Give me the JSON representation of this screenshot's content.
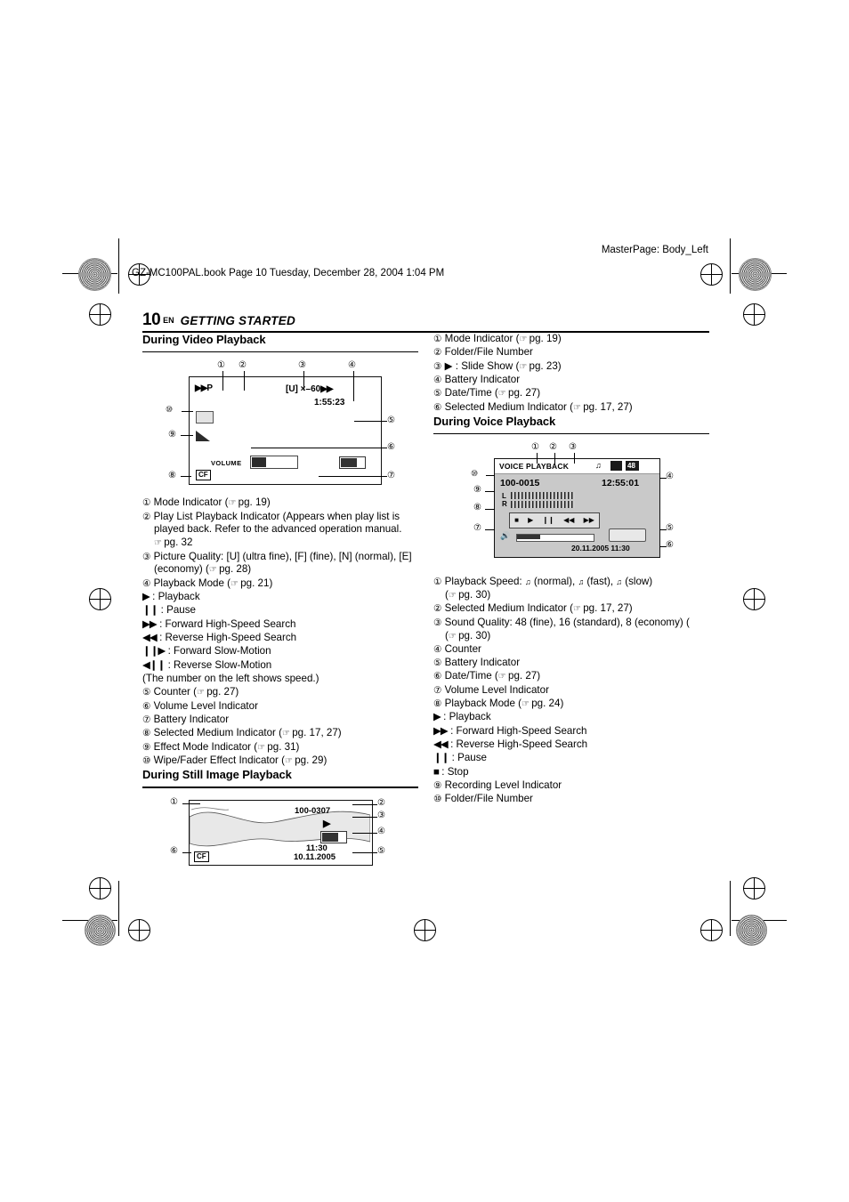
{
  "printmarks": {
    "masterpage": "MasterPage: Body_Left",
    "booktag": "GZ-MC100PAL.book  Page 10  Tuesday, December 28, 2004  1:04 PM"
  },
  "header": {
    "page_number": "10",
    "lang": "EN",
    "section_title": "GETTING STARTED"
  },
  "left_column": {
    "section1_title": "During Video Playback",
    "video_screen": {
      "mode": "P",
      "quality": "[U]",
      "speed": "×–60",
      "counter": "1:55:23",
      "volume_label": "VOLUME",
      "medium": "CF",
      "callouts": [
        "1",
        "2",
        "3",
        "4",
        "5",
        "6",
        "7",
        "8",
        "9",
        "10"
      ]
    },
    "items": [
      {
        "n": "1",
        "text": "Mode Indicator (",
        "ref": "pg. 19",
        "tail": ")"
      },
      {
        "n": "2",
        "text": "Play List Playback Indicator (Appears when play list is played back. Refer to the advanced operation manual. ",
        "ref": "pg. 32",
        "tail": ""
      },
      {
        "n": "3",
        "text": "Picture Quality: [U] (ultra fine), [F] (fine), [N] (normal), [E] (economy) (",
        "ref": "pg. 28",
        "tail": ")"
      },
      {
        "n": "4",
        "text": "Playback Mode (",
        "ref": "pg. 21",
        "tail": ")"
      },
      {
        "n": "5",
        "text": "Counter (",
        "ref": "pg. 27",
        "tail": ")"
      },
      {
        "n": "6",
        "text": "Volume Level Indicator",
        "ref": "",
        "tail": ""
      },
      {
        "n": "7",
        "text": "Battery Indicator",
        "ref": "",
        "tail": ""
      },
      {
        "n": "8",
        "text": "Selected Medium Indicator (",
        "ref": "pg. 17, 27",
        "tail": ")"
      },
      {
        "n": "9",
        "text": "Effect Mode Indicator (",
        "ref": "pg. 31",
        "tail": ")"
      },
      {
        "n": "10",
        "text": "Wipe/Fader Effect Indicator (",
        "ref": "pg. 29",
        "tail": ")"
      }
    ],
    "playback_modes": [
      {
        "icon": "▶",
        "label": ": Playback"
      },
      {
        "icon": "❙❙",
        "label": ": Pause"
      },
      {
        "icon": "▶▶",
        "label": ": Forward High-Speed Search"
      },
      {
        "icon": "◀◀",
        "label": ": Reverse High-Speed Search"
      },
      {
        "icon": "❙❙▶",
        "label": ": Forward Slow-Motion"
      },
      {
        "icon": "◀❙❙",
        "label": ": Reverse Slow-Motion"
      },
      {
        "icon": "",
        "label": "(The number on the left shows speed.)"
      }
    ],
    "section2_title": "During Still Image Playback",
    "still_screen": {
      "file_number": "100-0307",
      "play_icon": "▶",
      "time": "11:30",
      "date": "10.11.2005",
      "medium": "CF",
      "callouts": [
        "1",
        "2",
        "3",
        "4",
        "5",
        "6"
      ]
    }
  },
  "right_column": {
    "still_items": [
      {
        "n": "1",
        "text": "Mode Indicator (",
        "ref": "pg. 19",
        "tail": ")"
      },
      {
        "n": "2",
        "text": "Folder/File Number",
        "ref": "",
        "tail": ""
      },
      {
        "n": "3",
        "text": "▶ : Slide Show (",
        "ref": "pg. 23",
        "tail": ")"
      },
      {
        "n": "4",
        "text": "Battery Indicator",
        "ref": "",
        "tail": ""
      },
      {
        "n": "5",
        "text": "Date/Time (",
        "ref": "pg. 27",
        "tail": ")"
      },
      {
        "n": "6",
        "text": "Selected Medium Indicator (",
        "ref": "pg. 17, 27",
        "tail": ")"
      }
    ],
    "section_title": "During Voice Playback",
    "voice_screen": {
      "title": "VOICE PLAYBACK",
      "quality": "48",
      "file_number": "100-0015",
      "counter": "12:55:01",
      "ch_left": "L",
      "ch_right": "R",
      "datetime": "20.11.2005 11:30",
      "callouts": [
        "1",
        "2",
        "3",
        "4",
        "5",
        "6",
        "7",
        "8",
        "9",
        "10"
      ]
    },
    "items": [
      {
        "n": "1",
        "text": "Playback Speed:   (normal),   (fast),   (slow) (",
        "ref": "pg. 30",
        "tail": ")"
      },
      {
        "n": "2",
        "text": "Selected Medium Indicator (",
        "ref": "pg. 17, 27",
        "tail": ")"
      },
      {
        "n": "3",
        "text": "Sound Quality: 48 (fine), 16 (standard), 8 (economy) (",
        "ref": "pg. 30",
        "tail": ")"
      },
      {
        "n": "4",
        "text": "Counter",
        "ref": "",
        "tail": ""
      },
      {
        "n": "5",
        "text": "Battery Indicator",
        "ref": "",
        "tail": ""
      },
      {
        "n": "6",
        "text": "Date/Time (",
        "ref": "pg. 27",
        "tail": ")"
      },
      {
        "n": "7",
        "text": "Volume Level Indicator",
        "ref": "",
        "tail": ""
      },
      {
        "n": "8",
        "text": "Playback Mode (",
        "ref": "pg. 24",
        "tail": ")"
      },
      {
        "n": "9",
        "text": "Recording Level Indicator",
        "ref": "",
        "tail": ""
      },
      {
        "n": "10",
        "text": "Folder/File Number",
        "ref": "",
        "tail": ""
      }
    ],
    "voice_modes": [
      {
        "icon": "▶",
        "label": ": Playback"
      },
      {
        "icon": "▶▶",
        "label": ": Forward High-Speed Search"
      },
      {
        "icon": "◀◀",
        "label": ": Reverse High-Speed Search"
      },
      {
        "icon": "❙❙",
        "label": ": Pause"
      },
      {
        "icon": "■",
        "label": ": Stop"
      }
    ]
  }
}
